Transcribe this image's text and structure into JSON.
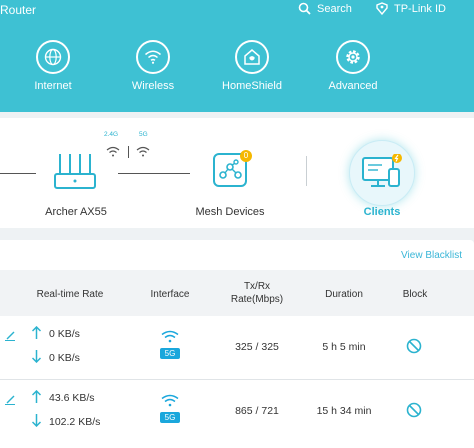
{
  "header": {
    "brand": "Router",
    "search_label": "Search",
    "account_label": "TP-Link ID"
  },
  "nav": {
    "internet": "Internet",
    "wireless": "Wireless",
    "homeshield": "HomeShield",
    "advanced": "Advanced"
  },
  "topology": {
    "router_name": "Archer AX55",
    "band_24": "2.4G",
    "band_5": "5G",
    "mesh_label": "Mesh Devices",
    "mesh_count": "0",
    "clients_label": "Clients"
  },
  "table": {
    "blacklist_link": "View Blacklist",
    "headers": {
      "rate": "Real-time Rate",
      "interface": "Interface",
      "txrx_line1": "Tx/Rx",
      "txrx_line2": "Rate(Mbps)",
      "duration": "Duration",
      "block": "Block"
    },
    "rows": [
      {
        "up": "0 KB/s",
        "down": "0 KB/s",
        "interface": "5G",
        "txrx": "325 / 325",
        "duration": "5 h 5 min"
      },
      {
        "up": "43.6 KB/s",
        "down": "102.2 KB/s",
        "interface": "5G",
        "txrx": "865 / 721",
        "duration": "15 h 34 min"
      }
    ]
  },
  "colors": {
    "header_bg": "#3ec1d3",
    "accent": "#3ab6d7",
    "badge": "#1aa7dc",
    "mesh_badge": "#f5b800"
  }
}
